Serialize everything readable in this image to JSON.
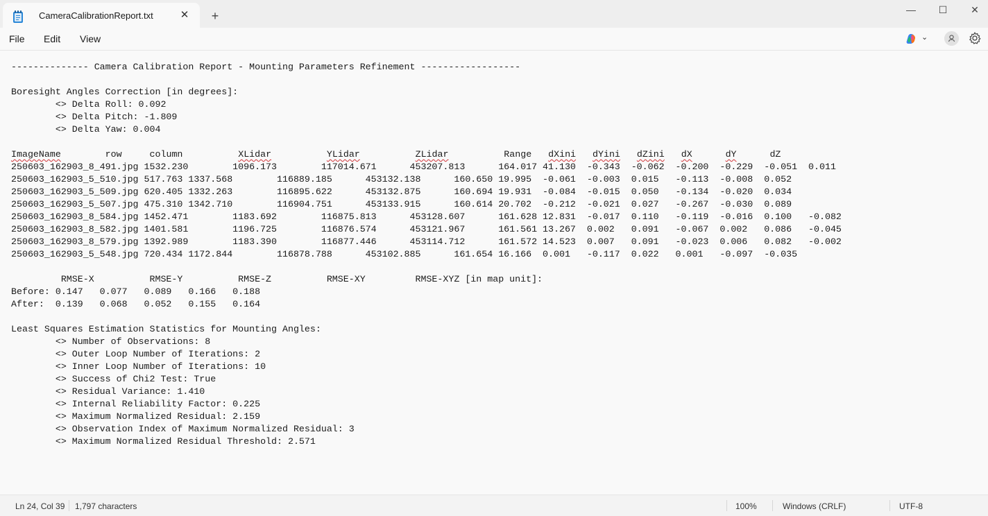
{
  "tab": {
    "title": "CameraCalibrationReport.txt",
    "close_glyph": "✕",
    "new_tab_glyph": "+"
  },
  "window_controls": {
    "minimize_glyph": "—",
    "maximize_glyph": "☐",
    "close_glyph": "✕"
  },
  "menu": {
    "file": "File",
    "edit": "Edit",
    "view": "View"
  },
  "toolbar_icons": [
    "notepad-app-icon",
    "copilot-icon",
    "chevron-down-icon",
    "account-icon",
    "gear-icon"
  ],
  "document": {
    "lines": [
      "-------------- Camera Calibration Report - Mounting Parameters Refinement ------------------",
      "",
      "Boresight Angles Correction [in degrees]:",
      "        <> Delta Roll: 0.092",
      "        <> Delta Pitch: -1.809",
      "        <> Delta Yaw: 0.004",
      "",
      "ImageName        row     column          XLidar          YLidar          ZLidar          Range   dXini   dYini   dZini   dX      dY      dZ",
      "250603_162903_8_491.jpg 1532.230        1096.173        117014.671      453207.813      164.017 41.130  -0.343  -0.062  -0.200  -0.229  -0.051  0.011",
      "250603_162903_5_510.jpg 517.763 1337.568        116889.185      453132.138      160.650 19.995  -0.061  -0.003  0.015   -0.113  -0.008  0.052",
      "250603_162903_5_509.jpg 620.405 1332.263        116895.622      453132.875      160.694 19.931  -0.084  -0.015  0.050   -0.134  -0.020  0.034",
      "250603_162903_5_507.jpg 475.310 1342.710        116904.751      453133.915      160.614 20.702  -0.212  -0.021  0.027   -0.267  -0.030  0.089",
      "250603_162903_8_584.jpg 1452.471        1183.692        116875.813      453128.607      161.628 12.831  -0.017  0.110   -0.119  -0.016  0.100   -0.082",
      "250603_162903_8_582.jpg 1401.581        1196.725        116876.574      453121.967      161.561 13.267  0.002   0.091   -0.067  0.002   0.086   -0.045",
      "250603_162903_8_579.jpg 1392.989        1183.390        116877.446      453114.712      161.572 14.523  0.007   0.091   -0.023  0.006   0.082   -0.002",
      "250603_162903_5_548.jpg 720.434 1172.844        116878.788      453102.885      161.654 16.166  0.001   -0.117  0.022   0.001   -0.097  -0.035",
      "",
      "         RMSE-X          RMSE-Y          RMSE-Z          RMSE-XY         RMSE-XYZ [in map unit]:",
      "Before: 0.147   0.077   0.089   0.166   0.188",
      "After:  0.139   0.068   0.052   0.155   0.164",
      "",
      "Least Squares Estimation Statistics for Mounting Angles:",
      "        <> Number of Observations: 8",
      "        <> Outer Loop Number of Iterations: 2",
      "        <> Inner Loop Number of Iterations: 10",
      "        <> Success of Chi2 Test: True",
      "        <> Residual Variance: 1.410",
      "        <> Internal Reliability Factor: 0.225",
      "        <> Maximum Normalized Residual: 2.159",
      "        <> Observation Index of Maximum Normalized Residual: 3",
      "        <> Maximum Normalized Residual Threshold: 2.571"
    ],
    "spellcheck_words": [
      "ImageName",
      "XLidar",
      "YLidar",
      "ZLidar",
      "dXini",
      "dYini",
      "dZini",
      "dX",
      "dY"
    ]
  },
  "status": {
    "position": "Ln 24, Col 39",
    "characters": "1,797 characters",
    "zoom": "100%",
    "line_ending": "Windows (CRLF)",
    "encoding": "UTF-8"
  },
  "colors": {
    "titlebar": "#eeeeee",
    "background": "#f9f9f9",
    "text": "#1a1a1a",
    "spellcheck": "#d13438"
  }
}
